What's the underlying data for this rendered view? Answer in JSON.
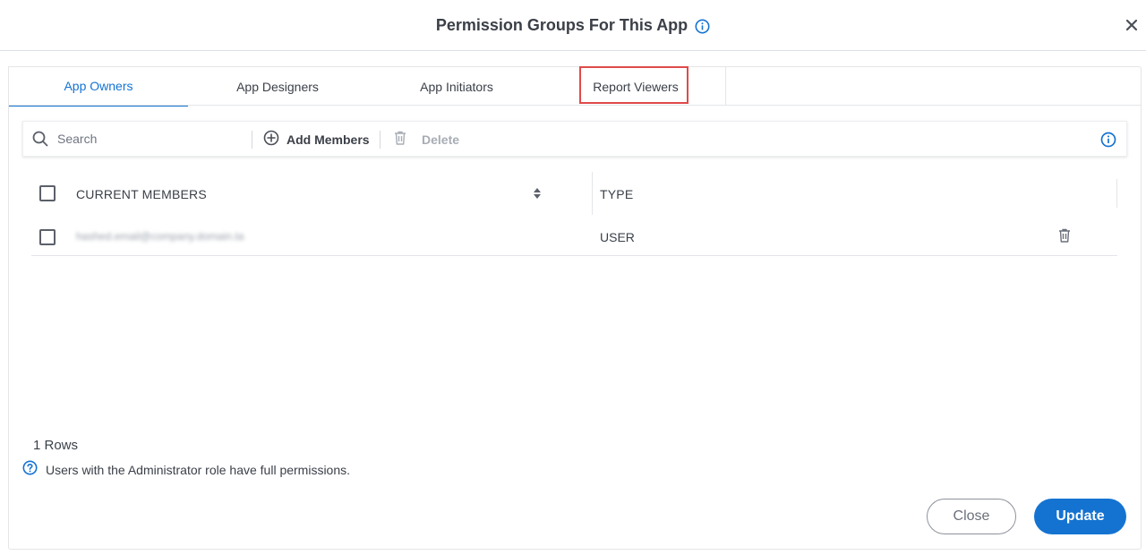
{
  "dialog": {
    "title": "Permission Groups For This App",
    "close_icon": "close-icon"
  },
  "tabs": [
    {
      "label": "App Owners",
      "active": true
    },
    {
      "label": "App Designers",
      "active": false
    },
    {
      "label": "App Initiators",
      "active": false
    },
    {
      "label": "Report Viewers",
      "active": false,
      "highlighted": true
    }
  ],
  "toolbar": {
    "search_placeholder": "Search",
    "add_members_label": "Add Members",
    "delete_label": "Delete"
  },
  "table": {
    "columns": [
      "CURRENT MEMBERS",
      "TYPE"
    ],
    "rows": [
      {
        "member": "hashed.email@company.domain.ta",
        "type": "USER"
      }
    ]
  },
  "footer": {
    "rows_count": "1 Rows",
    "note": "Users with the Administrator role have full permissions.",
    "close_label": "Close",
    "update_label": "Update"
  },
  "colors": {
    "accent": "#1473d1",
    "highlight_box": "#e04a4a",
    "text": "#3a3f48"
  }
}
